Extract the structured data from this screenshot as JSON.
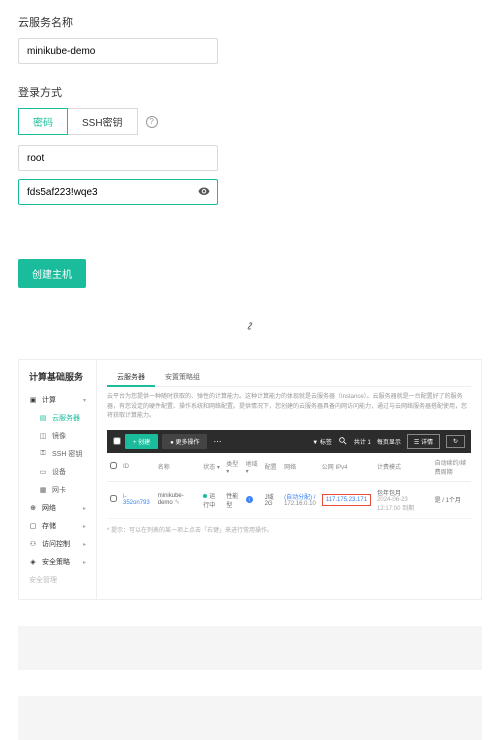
{
  "form": {
    "name_label": "云服务名称",
    "name_value": "minikube-demo",
    "login_label": "登录方式",
    "tab_pwd": "密码",
    "tab_ssh": "SSH密钥",
    "user_value": "root",
    "pwd_value": "fds5af223!wqe3"
  },
  "create_btn": "创建主机",
  "dash": {
    "side_title": "计算基础服务",
    "s_compute": "计算",
    "s_cloud": "云服务器",
    "s_image": "镜像",
    "s_ssh": "SSH 密钥",
    "s_device": "设备",
    "s_nic": "网卡",
    "s_net": "网络",
    "s_store": "存储",
    "s_acc": "访问控制",
    "s_sec": "安全策略",
    "s_secmgmt": "安全管理",
    "mtab1": "云服务器",
    "mtab2": "安置策略组",
    "desc": "云平台为您提供一种随时获取的、弹性的计算能力。这种计算能力的体现就是云服务器（Instance）。云服务器就是一台配置好了的服务器，有您设定的硬件配置、操作系统和网络配置。提供情况下，您创建的云服务器具备内网访问能力，通过与云网络服务器搭配使用，您将获取计算能力。",
    "tb_create": "+ 创建",
    "tb_more": "● 更多操作",
    "tb_filter": "▼ 标签",
    "tb_count": "共计 1",
    "tb_page": "每页显示",
    "tb_detail": "☰ 详情",
    "tb_refresh": "↻",
    "th_id": "ID",
    "th_name": "名称",
    "th_status": "状态",
    "th_type": "类型",
    "th_region": "地域",
    "th_conf": "配置",
    "th_net": "网络",
    "th_ip": "公网 IPv4",
    "th_bill": "计费模式",
    "th_auto": "自动续约/续费周期",
    "row": {
      "id": "i-352on793",
      "name": "minikube-demo",
      "status": "运行中",
      "type": "性能型",
      "region": "J域2G",
      "net_a": "(自动分配) /",
      "net_b": "172.16.0.10",
      "ip": "117.175.23.171",
      "bill_a": "包年包月",
      "bill_b": "2024-06-23 12:17:00 到期",
      "auto": "是 / 1个月"
    },
    "hint": "* 提示：可以在列表的某一项上点击「右键」来进行常用操作。"
  }
}
